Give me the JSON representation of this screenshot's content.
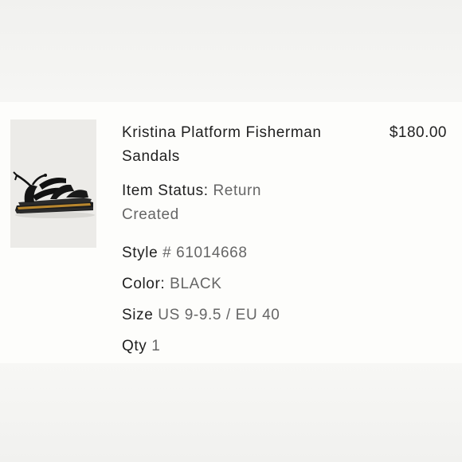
{
  "product": {
    "name": "Kristina Platform Fisherman Sandals",
    "price": "$180.00",
    "image": "black fisherman platform sandal photo"
  },
  "details": {
    "status_label": "Item Status:",
    "status_value": "Return Created",
    "style_label": "Style",
    "style_value": "# 61014668",
    "color_label": "Color:",
    "color_value": "BLACK",
    "size_label": "Size",
    "size_value": "US 9-9.5 / EU 40",
    "qty_label": "Qty",
    "qty_value": "1"
  }
}
